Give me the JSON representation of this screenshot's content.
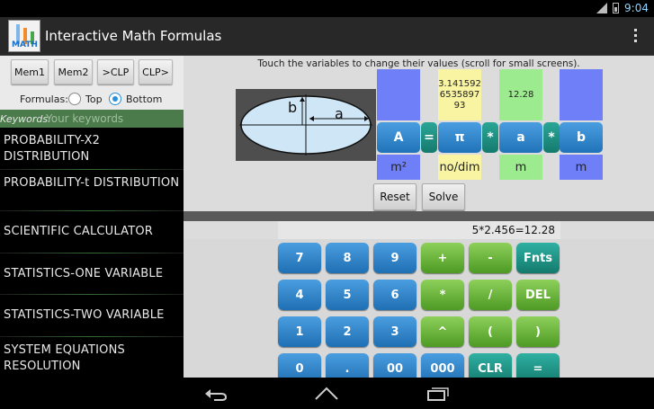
{
  "status": {
    "time": "9:04",
    "signal_label": "3G"
  },
  "app": {
    "title": "Interactive Math Formulas",
    "icon_text": "MATH"
  },
  "memory": {
    "buttons": [
      "Mem1",
      "Mem2",
      ">CLP",
      "CLP>"
    ]
  },
  "formulas_position": {
    "label": "Formulas:",
    "options": [
      "Top",
      "Bottom"
    ],
    "selected": "Bottom"
  },
  "keywords": {
    "label": "Keywords:",
    "placeholder": "Your keywords"
  },
  "formula_list": [
    "PROBABILITY-X2 DISTRIBUTION",
    "PROBABILITY-t DISTRIBUTION",
    "SCIENTIFIC CALCULATOR",
    "STATISTICS-ONE VARIABLE",
    "STATISTICS-TWO VARIABLE",
    "SYSTEM EQUATIONS RESOLUTION"
  ],
  "formula": {
    "hint": "Touch the variables to change their values (scroll for small screens).",
    "figure_labels": {
      "b": "b",
      "a": "a"
    },
    "variables": [
      {
        "symbol": "A",
        "value": "",
        "unit": "m²",
        "color": "#6f7ff7"
      },
      {
        "symbol": "π",
        "value": "3.141592\n6535897\n93",
        "unit": "no/dim",
        "color": "#f8f4a2"
      },
      {
        "symbol": "a",
        "value": "12.28",
        "unit": "m",
        "color": "#9ceb8e"
      },
      {
        "symbol": "b",
        "value": "",
        "unit": "m",
        "color": "#6f7ff7"
      }
    ],
    "operators": [
      "=",
      "*",
      "*"
    ],
    "reset_label": "Reset",
    "solve_label": "Solve"
  },
  "calculator": {
    "display": "5*2.456=12.28",
    "rows": [
      [
        "7",
        "8",
        "9",
        "+",
        "-",
        "Fnts"
      ],
      [
        "4",
        "5",
        "6",
        "*",
        "/",
        "DEL"
      ],
      [
        "1",
        "2",
        "3",
        "^",
        "(",
        ")"
      ],
      [
        "0",
        ".",
        "00",
        "000",
        "CLR",
        "="
      ]
    ]
  },
  "colors": {
    "number_key": "#2a7fc8",
    "operator_key": "#62b035",
    "function_key": "#1f9688",
    "list_text": "#e8e8e8"
  }
}
